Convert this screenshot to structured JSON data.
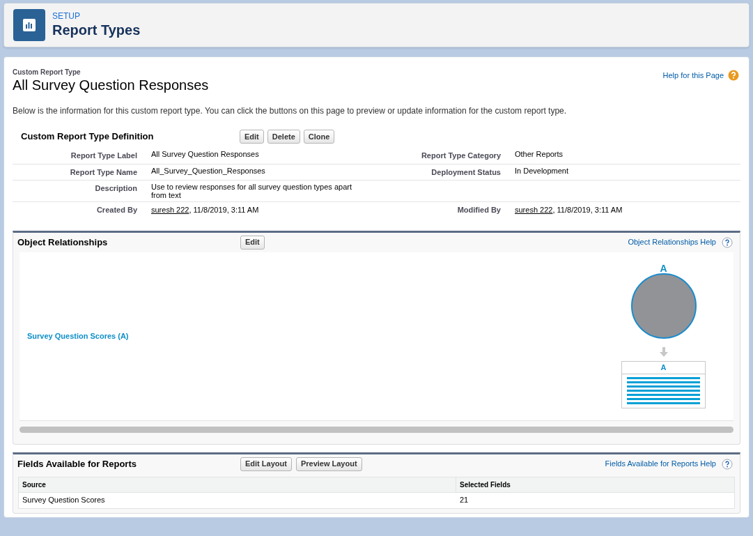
{
  "header": {
    "eyebrow": "SETUP",
    "title": "Report Types"
  },
  "page": {
    "subtitle": "Custom Report Type",
    "title": "All Survey Question Responses",
    "help_link": "Help for this Page",
    "intro": "Below is the information for this custom report type. You can click the buttons on this page to preview or update information for the custom report type."
  },
  "definition": {
    "title": "Custom Report Type Definition",
    "buttons": [
      "Edit",
      "Delete",
      "Clone"
    ],
    "rows": [
      {
        "left": {
          "label": "Report Type Label",
          "value": "All Survey Question Responses"
        },
        "right": {
          "label": "Report Type Category",
          "value": "Other Reports"
        }
      },
      {
        "left": {
          "label": "Report Type Name",
          "value": "All_Survey_Question_Responses"
        },
        "right": {
          "label": "Deployment Status",
          "value": "In Development"
        }
      },
      {
        "left": {
          "label": "Description",
          "value": "Use to review responses for all survey question types apart from text"
        }
      },
      {
        "left": {
          "label": "Created By",
          "user": "suresh 222",
          "value": ", 11/8/2019, 3:11 AM"
        },
        "right": {
          "label": "Modified By",
          "user": "suresh 222",
          "value": ", 11/8/2019, 3:11 AM"
        }
      }
    ]
  },
  "relationships": {
    "title": "Object Relationships",
    "buttons": [
      "Edit"
    ],
    "help_link": "Object Relationships Help",
    "object_link": "Survey Question Scores (A)",
    "diagram": {
      "circle_label": "A",
      "table_label": "A"
    }
  },
  "fields": {
    "title": "Fields Available for Reports",
    "buttons": [
      "Edit Layout",
      "Preview Layout"
    ],
    "help_link": "Fields Available for Reports Help",
    "columns": [
      "Source",
      "Selected Fields"
    ],
    "rows": [
      [
        "Survey Question Scores",
        "21"
      ]
    ]
  }
}
